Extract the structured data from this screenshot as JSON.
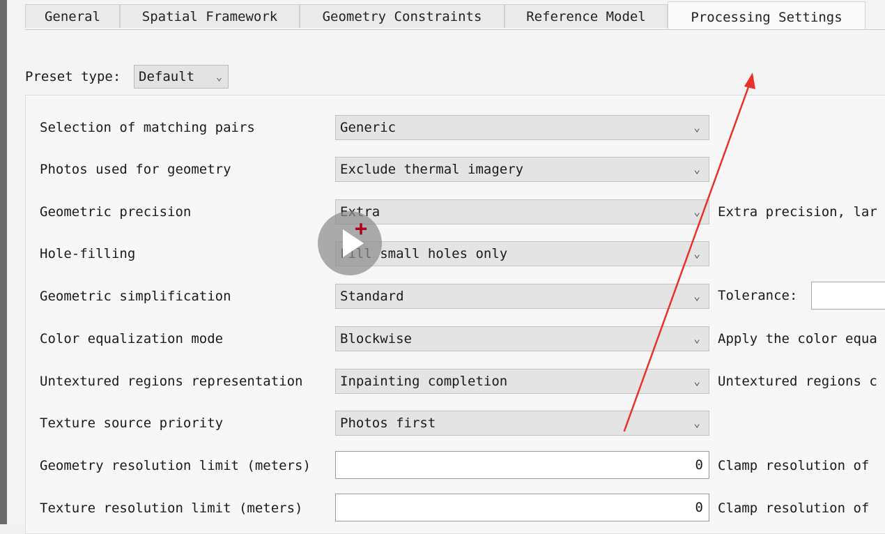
{
  "tabs": [
    {
      "label": "General"
    },
    {
      "label": "Spatial Framework"
    },
    {
      "label": "Geometry Constraints"
    },
    {
      "label": "Reference Model"
    },
    {
      "label": "Processing Settings"
    }
  ],
  "preset": {
    "label": "Preset type:",
    "value": "Default"
  },
  "settings": {
    "matching_pairs": {
      "label": "Selection of matching pairs",
      "value": "Generic"
    },
    "photos_geometry": {
      "label": "Photos used for geometry",
      "value": "Exclude thermal imagery"
    },
    "geo_precision": {
      "label": "Geometric precision",
      "value": "Extra",
      "desc": "Extra precision, lar"
    },
    "hole_filling": {
      "label": "Hole-filling",
      "value": "Fill small holes only"
    },
    "geo_simplification": {
      "label": "Geometric simplification",
      "value": "Standard",
      "tolerance_label": "Tolerance:"
    },
    "color_eq": {
      "label": "Color equalization mode",
      "value": "Blockwise",
      "desc": "Apply the color equa"
    },
    "untextured": {
      "label": "Untextured regions representation",
      "value": "Inpainting completion",
      "desc": "Untextured regions c"
    },
    "texture_priority": {
      "label": "Texture source priority",
      "value": "Photos first"
    },
    "geo_res_limit": {
      "label": "Geometry resolution limit (meters)",
      "value": "0",
      "desc": "Clamp resolution of"
    },
    "tex_res_limit": {
      "label": "Texture resolution limit (meters)",
      "value": "0",
      "desc": "Clamp resolution of"
    }
  },
  "overlay": {
    "arrow_color": "#e8312a",
    "plus_color": "#b00018",
    "plus_text": "+"
  }
}
